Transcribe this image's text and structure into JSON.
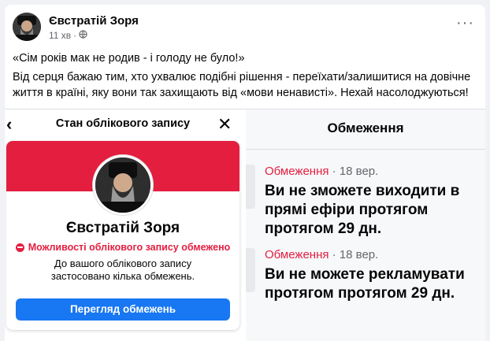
{
  "post": {
    "author": "Євстратій Зоря",
    "time": "11 хв",
    "separator": "·",
    "more_label": "···",
    "paragraphs": [
      "«Сім років мак не родив - і голоду не було!»",
      "Від серця бажаю тим, хто ухвалює подібні рішення - переїхати/залишитися на довічне життя в країні, яку вони так захищають від «мови ненависті». Нехай насолоджуються!"
    ]
  },
  "account_status": {
    "back_label": "‹",
    "title": "Стан облікового запису",
    "close_label": "✕",
    "name": "Євстратій Зоря",
    "restricted_label": "Можливості облікового запису обмежено",
    "description": "До вашого облікового запису застосовано кілька обмежень.",
    "button_label": "Перегляд обмежень"
  },
  "restrictions": {
    "title": "Обмеження",
    "items": [
      {
        "tag": "Обмеження",
        "date": " · 18 вер.",
        "text": "Ви не зможете виходити в прямі ефіри протягом протягом 29 дн."
      },
      {
        "tag": "Обмеження",
        "date": " · 18 вер.",
        "text": "Ви не можете рекламувати протягом протягом 29 дн."
      }
    ]
  },
  "colors": {
    "accent_red": "#e41e3f",
    "primary_blue": "#1877f2"
  },
  "icons": {
    "globe": "globe-icon",
    "restricted": "restricted-icon"
  }
}
